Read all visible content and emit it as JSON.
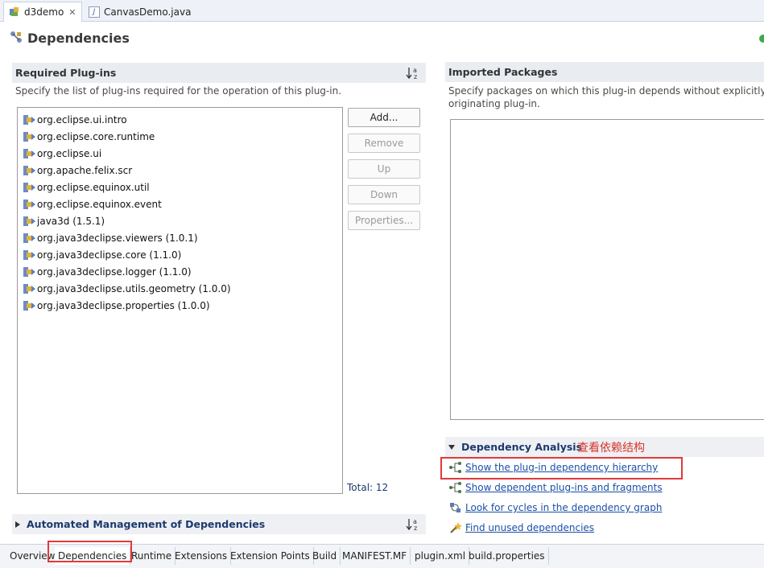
{
  "editor_tabs": [
    {
      "label": "d3demo",
      "active": true,
      "icon": "plugin-manifest-icon"
    },
    {
      "label": "CanvasDemo.java",
      "active": false,
      "icon": "java-file-icon"
    }
  ],
  "page": {
    "title": "Dependencies",
    "icon": "dependencies-icon"
  },
  "required": {
    "title": "Required Plug-ins",
    "description": "Specify the list of plug-ins required for the operation of this plug-in.",
    "items": [
      "org.eclipse.ui.intro",
      "org.eclipse.core.runtime",
      "org.eclipse.ui",
      "org.apache.felix.scr",
      "org.eclipse.equinox.util",
      "org.eclipse.equinox.event",
      "java3d (1.5.1)",
      "org.java3declipse.viewers (1.0.1)",
      "org.java3declipse.core (1.1.0)",
      "org.java3declipse.logger (1.1.0)",
      "org.java3declipse.utils.geometry (1.0.0)",
      "org.java3declipse.properties (1.0.0)"
    ],
    "buttons": {
      "add": "Add...",
      "remove": "Remove",
      "up": "Up",
      "down": "Down",
      "properties": "Properties..."
    },
    "total": "Total: 12"
  },
  "imported": {
    "title": "Imported Packages",
    "description_line1": "Specify packages on which this plug-in depends without explicitly id",
    "description_line2": "originating plug-in."
  },
  "analysis": {
    "title": "Dependency Analysis",
    "annotation": "查看依赖结构",
    "links": [
      "Show the plug-in dependency hierarchy",
      "Show dependent plug-ins and fragments",
      "Look for cycles in the dependency graph",
      "Find unused dependencies"
    ]
  },
  "automated": {
    "title": "Automated Management of Dependencies"
  },
  "bottom_tabs": [
    "Overview",
    "Dependencies",
    "Runtime",
    "Extensions",
    "Extension Points",
    "Build",
    "MANIFEST.MF",
    "plugin.xml",
    "build.properties"
  ],
  "active_bottom_tab": "Dependencies",
  "colors": {
    "link": "#1a4fa8",
    "annotation": "#d9342b",
    "highlight_box": "#e2393a"
  }
}
